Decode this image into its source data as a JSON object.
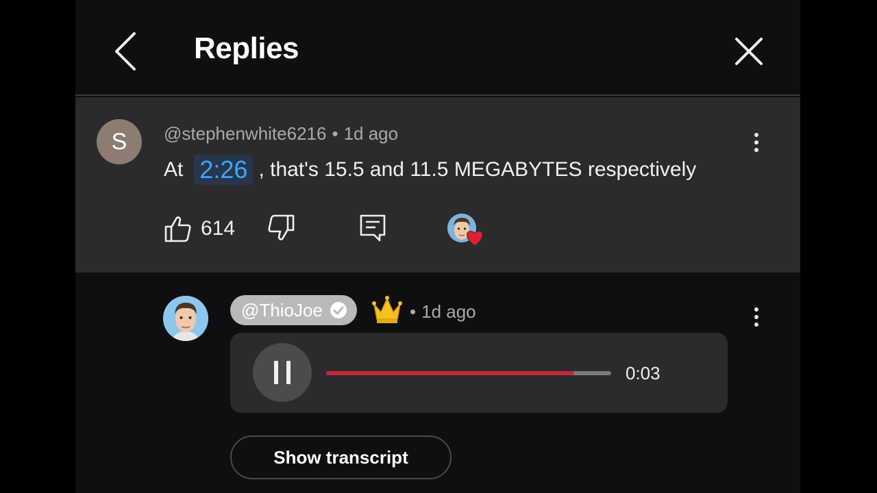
{
  "header": {
    "title": "Replies"
  },
  "parent_comment": {
    "avatar_letter": "S",
    "author": "@stephenwhite6216",
    "separator": "•",
    "age": "1d ago",
    "text_prefix": "At",
    "timestamp_link": "2:26",
    "text_suffix": ", that's 15.5 and 11.5 MEGABYTES respectively",
    "like_count": "614",
    "colors": {
      "avatar_bg": "#8c7d70",
      "heart": "#e0202e",
      "timestamp_link": "#3ea6ff"
    }
  },
  "reply": {
    "author": "@ThioJoe",
    "verified": true,
    "badge_icon": "crown-icon",
    "separator": "•",
    "age": "1d ago",
    "audio": {
      "elapsed": "0:03",
      "progress": 0.87,
      "state": "playing"
    },
    "show_transcript_label": "Show transcript",
    "colors": {
      "progress_fill": "#c5263a",
      "progress_track": "#7b7b7b",
      "author_chip": "#b9b9b9"
    }
  }
}
